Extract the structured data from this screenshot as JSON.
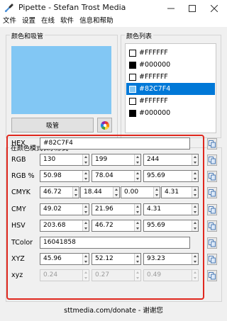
{
  "window": {
    "title": "Pipette - Stefan Trost Media",
    "controls": [
      "minimize",
      "maximize",
      "close"
    ]
  },
  "menu": [
    "文件",
    "设置",
    "在线",
    "软件",
    "信息和帮助"
  ],
  "picker": {
    "group_title": "颜色和吸管",
    "preview_color": "#82C7F4",
    "pick_label": "吸管",
    "wheel_icon": "color-wheel-icon"
  },
  "color_list": {
    "title": "颜色列表",
    "selected_index": 2,
    "items": [
      {
        "label": "#FFFFFF",
        "color": "#FFFFFF"
      },
      {
        "label": "#000000",
        "color": "#000000"
      },
      {
        "label": "#FFFFFF",
        "color": "#FFFFFF"
      },
      {
        "label": "#82C7F4",
        "color": "#82C7F4"
      },
      {
        "label": "#FFFFFF",
        "color": "#FFFFFF"
      },
      {
        "label": "#000000",
        "color": "#000000"
      }
    ]
  },
  "formats": {
    "title": "在颜色模式表示形式",
    "highlight_color": "#e0281e",
    "rows": [
      {
        "label": "HEX",
        "values": [
          "#82C7F4"
        ],
        "spin": false
      },
      {
        "label": "RGB",
        "values": [
          "130",
          "199",
          "244"
        ],
        "spin": true
      },
      {
        "label": "RGB %",
        "values": [
          "50.98",
          "78.04",
          "95.69"
        ],
        "spin": true
      },
      {
        "label": "CMYK",
        "values": [
          "46.72",
          "18.44",
          "0.00",
          "4.31"
        ],
        "spin": true
      },
      {
        "label": "CMY",
        "values": [
          "49.02",
          "21.96",
          "4.31"
        ],
        "spin": true
      },
      {
        "label": "HSV",
        "values": [
          "203.68",
          "46.72",
          "95.69"
        ],
        "spin": true
      },
      {
        "label": "TColor",
        "values": [
          "16041858"
        ],
        "spin": false
      },
      {
        "label": "XYZ",
        "values": [
          "45.96",
          "52.12",
          "93.23"
        ],
        "spin": true
      },
      {
        "label": "xyz",
        "values": [
          "0.24",
          "0.27",
          "0.49"
        ],
        "spin": true,
        "disabled": true
      }
    ]
  },
  "footer": "sttmedia.com/donate - 谢谢您"
}
